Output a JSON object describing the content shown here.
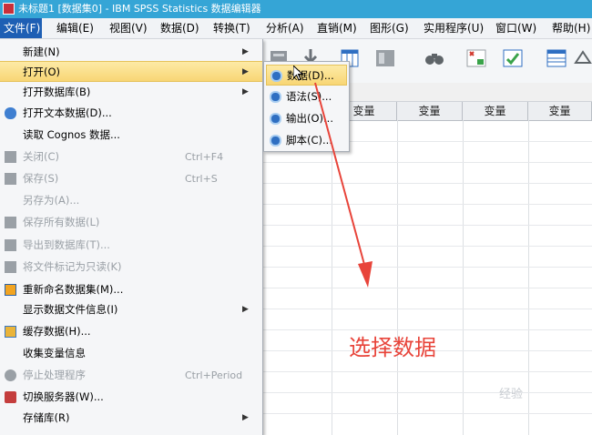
{
  "window": {
    "title": "未标题1 [数据集0] - IBM SPSS Statistics 数据编辑器"
  },
  "menubar": [
    {
      "label": "文件(F)",
      "active": true
    },
    {
      "label": "编辑(E)"
    },
    {
      "label": "视图(V)"
    },
    {
      "label": "数据(D)"
    },
    {
      "label": "转换(T)"
    },
    {
      "label": "分析(A)"
    },
    {
      "label": "直销(M)"
    },
    {
      "label": "图形(G)"
    },
    {
      "label": "实用程序(U)"
    },
    {
      "label": "窗口(W)"
    },
    {
      "label": "帮助(H)"
    }
  ],
  "file_menu": {
    "items": [
      {
        "label": "新建(N)",
        "submenu": true
      },
      {
        "label": "打开(O)",
        "submenu": true,
        "highlight": true
      },
      {
        "label": "打开数据库(B)",
        "submenu": true
      },
      {
        "label": "打开文本数据(D)...",
        "icon": "open-text-data-icon"
      },
      {
        "label": "读取 Cognos 数据..."
      },
      {
        "label": "关闭(C)",
        "shortcut": "Ctrl+F4",
        "disabled": true,
        "icon": "close-file-icon"
      },
      {
        "label": "保存(S)",
        "shortcut": "Ctrl+S",
        "disabled": true,
        "icon": "save-icon"
      },
      {
        "label": "另存为(A)...",
        "disabled": true
      },
      {
        "label": "保存所有数据(L)",
        "disabled": true,
        "icon": "save-all-icon"
      },
      {
        "label": "导出到数据库(T)...",
        "disabled": true,
        "icon": "export-database-icon"
      },
      {
        "label": "将文件标记为只读(K)",
        "disabled": true,
        "icon": "read-only-icon"
      },
      {
        "label": "重新命名数据集(M)...",
        "icon": "rename-dataset-icon"
      },
      {
        "label": "显示数据文件信息(I)",
        "submenu": true
      },
      {
        "label": "缓存数据(H)...",
        "icon": "cache-data-icon"
      },
      {
        "label": "收集变量信息"
      },
      {
        "label": "停止处理程序",
        "shortcut": "Ctrl+Period",
        "disabled": true,
        "icon": "stop-processor-icon"
      },
      {
        "label": "切换服务器(W)...",
        "icon": "switch-server-icon"
      },
      {
        "label": "存储库(R)",
        "submenu": true
      }
    ]
  },
  "open_submenu": {
    "items": [
      {
        "label": "数据(D)...",
        "highlight": true
      },
      {
        "label": "语法(S)..."
      },
      {
        "label": "输出(O)..."
      },
      {
        "label": "脚本(C)..."
      }
    ]
  },
  "grid": {
    "column_headers": [
      "变量",
      "变量",
      "变量",
      "变量"
    ]
  },
  "annotation": {
    "text": "选择数据",
    "color": "#e8443a"
  },
  "watermark": "经验"
}
